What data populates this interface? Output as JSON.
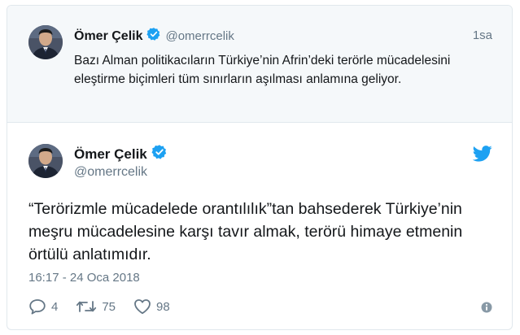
{
  "parent_tweet": {
    "author_name": "Ömer Çelik",
    "handle": "@omerrcelik",
    "time": "1sa",
    "text": "Bazı Alman politikacıların Türkiye’nin Afrin’deki terörle mücadelesini eleştirme biçimleri tüm sınırların aşılması anlamına geliyor."
  },
  "main_tweet": {
    "author_name": "Ömer Çelik",
    "handle": "@omerrcelik",
    "text": "“Terörizmle mücadelede orantılılık”tan bahsederek Türkiye’nin meşru mücadelesine karşı tavır almak, terörü himaye etmenin örtülü anlatımıdır.",
    "timestamp": "16:17 - 24 Oca 2018",
    "replies": "4",
    "retweets": "75",
    "likes": "98"
  },
  "icons": {
    "verified": "verified-badge-icon",
    "brand": "twitter-bird-icon",
    "reply": "reply-icon",
    "retweet": "retweet-icon",
    "like": "heart-icon",
    "info": "info-icon"
  },
  "colors": {
    "brand": "#1da1f2",
    "secondary_text": "#657786",
    "parent_background": "#f5f8fa",
    "border": "#e1e8ed"
  }
}
